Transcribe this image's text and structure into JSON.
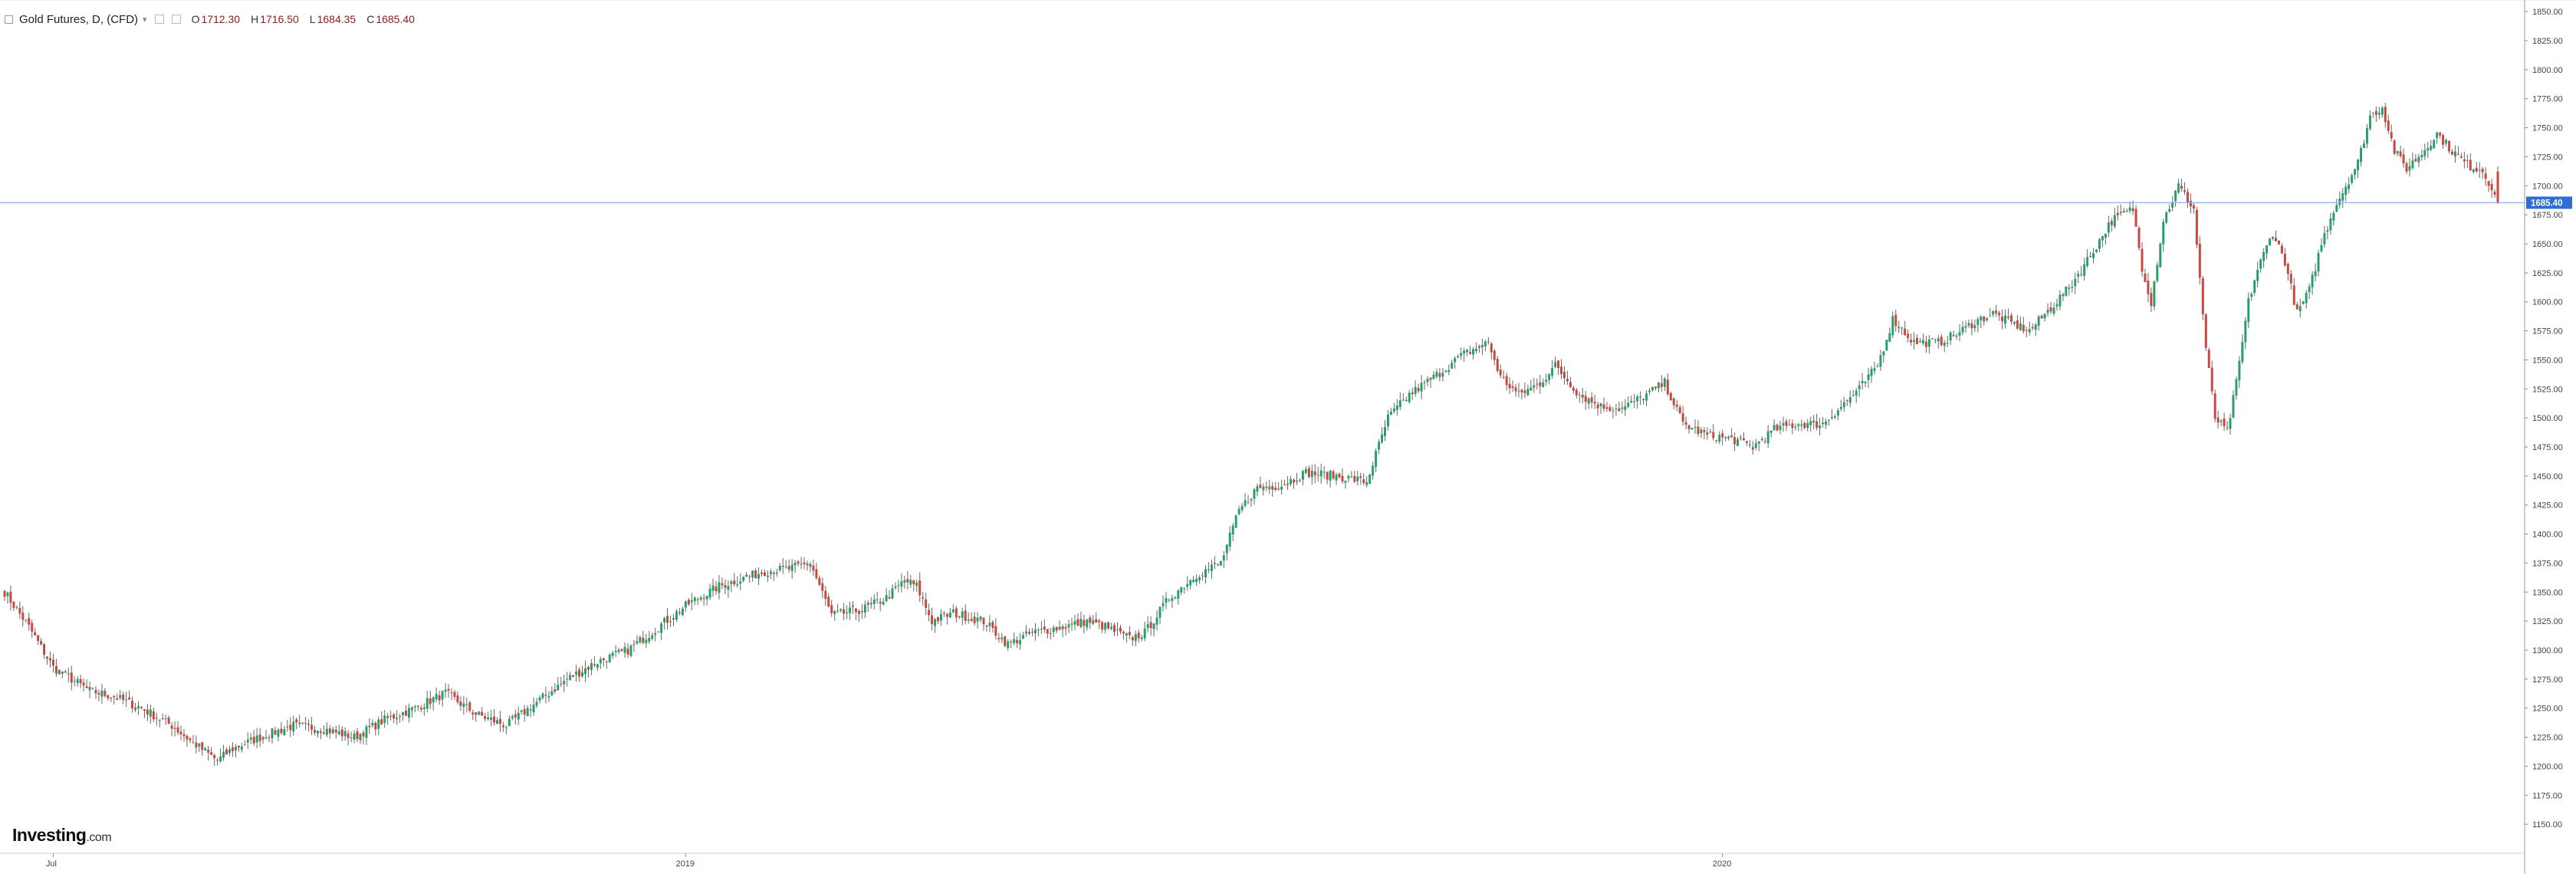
{
  "header": {
    "title": "Gold Futures, D, (CFD)",
    "open_label": "O",
    "open": "1712.30",
    "high_label": "H",
    "high": "1716.50",
    "low_label": "L",
    "low": "1684.35",
    "close_label": "C",
    "close": "1685.40"
  },
  "logo": {
    "brand": "Investing",
    "suffix": ".com"
  },
  "colors": {
    "up": "#26a069",
    "down": "#c9473f",
    "wick": "#666666",
    "last_line": "#8fb1e3",
    "last_tag": "#2f6fd4",
    "grid_axis": "#bfbfbf"
  },
  "chart_data": {
    "type": "candlestick",
    "title": "Gold Futures, D, (CFD)",
    "last_price": 1685.4,
    "ylim": [
      1125,
      1860
    ],
    "yticks": [
      1150,
      1175,
      1200,
      1225,
      1250,
      1275,
      1300,
      1325,
      1350,
      1375,
      1400,
      1425,
      1450,
      1475,
      1500,
      1525,
      1550,
      1575,
      1600,
      1625,
      1650,
      1675,
      1700,
      1725,
      1750,
      1775,
      1800,
      1825,
      1850
    ],
    "ytick_labels": [
      "1150.00",
      "1175.00",
      "1200.00",
      "1225.00",
      "1250.00",
      "1275.00",
      "1300.00",
      "1325.00",
      "1350.00",
      "1375.00",
      "1400.00",
      "1425.00",
      "1450.00",
      "1475.00",
      "1500.00",
      "1525.00",
      "1550.00",
      "1575.00",
      "1600.00",
      "1625.00",
      "1650.00",
      "1675.00",
      "1700.00",
      "1725.00",
      "1750.00",
      "1775.00",
      "1800.00",
      "1825.00",
      "1850.00"
    ],
    "last_price_label": "1685.40",
    "x_labels": [
      {
        "label": "Jul",
        "index": 16
      },
      {
        "label": "2019",
        "index": 224
      },
      {
        "label": "2020",
        "index": 565
      }
    ],
    "anchors": [
      [
        0,
        1350
      ],
      [
        8,
        1320
      ],
      [
        16,
        1285
      ],
      [
        28,
        1265
      ],
      [
        36,
        1260
      ],
      [
        45,
        1250
      ],
      [
        55,
        1235
      ],
      [
        62,
        1220
      ],
      [
        70,
        1205
      ],
      [
        75,
        1215
      ],
      [
        84,
        1225
      ],
      [
        95,
        1235
      ],
      [
        105,
        1232
      ],
      [
        115,
        1225
      ],
      [
        125,
        1240
      ],
      [
        135,
        1250
      ],
      [
        145,
        1263
      ],
      [
        155,
        1245
      ],
      [
        165,
        1235
      ],
      [
        175,
        1255
      ],
      [
        185,
        1275
      ],
      [
        195,
        1290
      ],
      [
        205,
        1300
      ],
      [
        215,
        1320
      ],
      [
        225,
        1340
      ],
      [
        235,
        1355
      ],
      [
        250,
        1368
      ],
      [
        258,
        1370
      ],
      [
        265,
        1375
      ],
      [
        272,
        1330
      ],
      [
        282,
        1335
      ],
      [
        290,
        1345
      ],
      [
        296,
        1360
      ],
      [
        300,
        1355
      ],
      [
        305,
        1325
      ],
      [
        312,
        1332
      ],
      [
        322,
        1325
      ],
      [
        330,
        1305
      ],
      [
        338,
        1315
      ],
      [
        348,
        1320
      ],
      [
        356,
        1325
      ],
      [
        362,
        1320
      ],
      [
        370,
        1310
      ],
      [
        375,
        1315
      ],
      [
        383,
        1345
      ],
      [
        392,
        1365
      ],
      [
        400,
        1375
      ],
      [
        406,
        1420
      ],
      [
        412,
        1440
      ],
      [
        420,
        1442
      ],
      [
        428,
        1453
      ],
      [
        438,
        1450
      ],
      [
        448,
        1445
      ],
      [
        455,
        1500
      ],
      [
        462,
        1520
      ],
      [
        470,
        1535
      ],
      [
        480,
        1555
      ],
      [
        488,
        1565
      ],
      [
        492,
        1535
      ],
      [
        498,
        1520
      ],
      [
        505,
        1530
      ],
      [
        510,
        1545
      ],
      [
        518,
        1520
      ],
      [
        525,
        1510
      ],
      [
        532,
        1508
      ],
      [
        540,
        1520
      ],
      [
        546,
        1530
      ],
      [
        552,
        1495
      ],
      [
        560,
        1485
      ],
      [
        568,
        1482
      ],
      [
        575,
        1475
      ],
      [
        582,
        1490
      ],
      [
        590,
        1495
      ],
      [
        598,
        1495
      ],
      [
        604,
        1510
      ],
      [
        610,
        1525
      ],
      [
        616,
        1545
      ],
      [
        621,
        1585
      ],
      [
        628,
        1565
      ],
      [
        636,
        1565
      ],
      [
        642,
        1572
      ],
      [
        648,
        1583
      ],
      [
        654,
        1590
      ],
      [
        660,
        1582
      ],
      [
        666,
        1575
      ],
      [
        672,
        1592
      ],
      [
        679,
        1612
      ],
      [
        686,
        1640
      ],
      [
        693,
        1670
      ],
      [
        700,
        1680
      ],
      [
        703,
        1630
      ],
      [
        706,
        1600
      ],
      [
        710,
        1670
      ],
      [
        715,
        1700
      ],
      [
        720,
        1680
      ],
      [
        724,
        1560
      ],
      [
        727,
        1500
      ],
      [
        731,
        1488
      ],
      [
        734,
        1530
      ],
      [
        738,
        1600
      ],
      [
        741,
        1628
      ],
      [
        746,
        1660
      ],
      [
        750,
        1635
      ],
      [
        754,
        1590
      ],
      [
        758,
        1610
      ],
      [
        762,
        1650
      ],
      [
        766,
        1680
      ],
      [
        770,
        1700
      ],
      [
        774,
        1720
      ],
      [
        778,
        1760
      ],
      [
        782,
        1768
      ],
      [
        786,
        1730
      ],
      [
        790,
        1715
      ],
      [
        795,
        1728
      ],
      [
        800,
        1745
      ],
      [
        805,
        1730
      ],
      [
        810,
        1718
      ],
      [
        815,
        1713
      ],
      [
        818,
        1699
      ],
      [
        820,
        1685.4
      ]
    ]
  }
}
